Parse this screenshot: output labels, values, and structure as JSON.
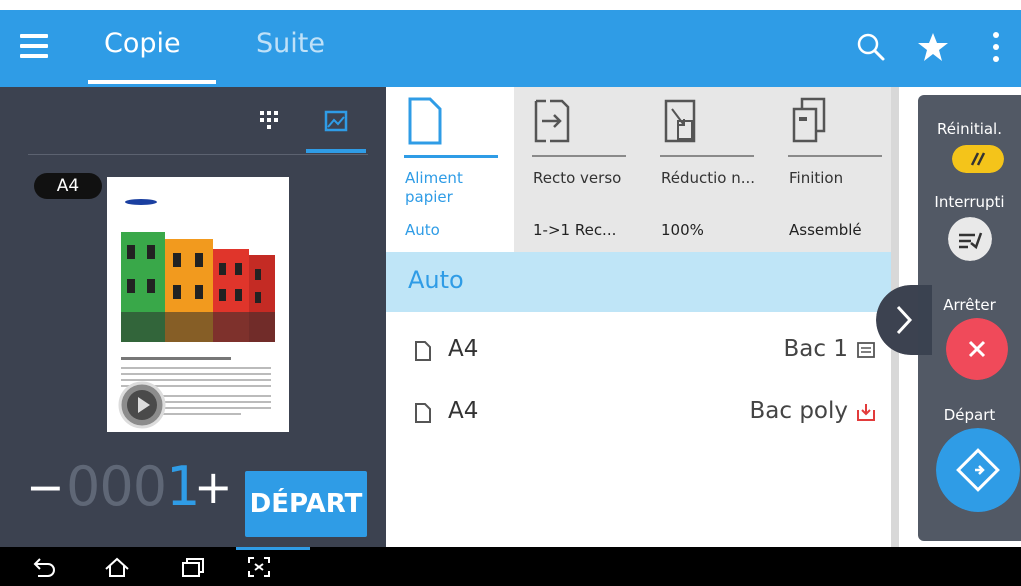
{
  "header": {
    "tabs": [
      {
        "label": "Copie",
        "active": true
      },
      {
        "label": "Suite",
        "active": false
      }
    ],
    "icons": [
      "menu-icon",
      "search-icon",
      "star-icon",
      "kebab-icon"
    ]
  },
  "preview": {
    "paper_size_badge": "A4",
    "quantity_prefix": "000",
    "quantity_last": "1",
    "minus_label": "−",
    "plus_label": "+",
    "depart_label": "DÉPART"
  },
  "functions": [
    {
      "label": "Aliment papier",
      "value": "Auto",
      "active": true,
      "icon": "paper-icon"
    },
    {
      "label": "Recto verso",
      "value": "1->1 Rec...",
      "active": false,
      "icon": "duplex-icon"
    },
    {
      "label": "Réductio n...",
      "value": "100%",
      "active": false,
      "icon": "reduce-icon"
    },
    {
      "label": "Finition",
      "value": "Assemblé",
      "active": false,
      "icon": "finishing-icon"
    }
  ],
  "paper_options": {
    "selected": "Auto",
    "items": [
      {
        "size": "A4",
        "tray": "Bac 1",
        "tray_icon": "tray-icon"
      },
      {
        "size": "A4",
        "tray": "Bac poly",
        "tray_icon": "bypass-tray-icon"
      }
    ]
  },
  "actions": {
    "reset_label": "Réinitial.",
    "interrupt_label": "Interrupti",
    "stop_label": "Arrêter",
    "start_label": "Départ"
  },
  "colors": {
    "accent": "#2f9ce6",
    "panel_dark": "#3c4250",
    "reset": "#f4c41a",
    "stop": "#f04a5a",
    "selected_row": "#bfe5f7"
  }
}
